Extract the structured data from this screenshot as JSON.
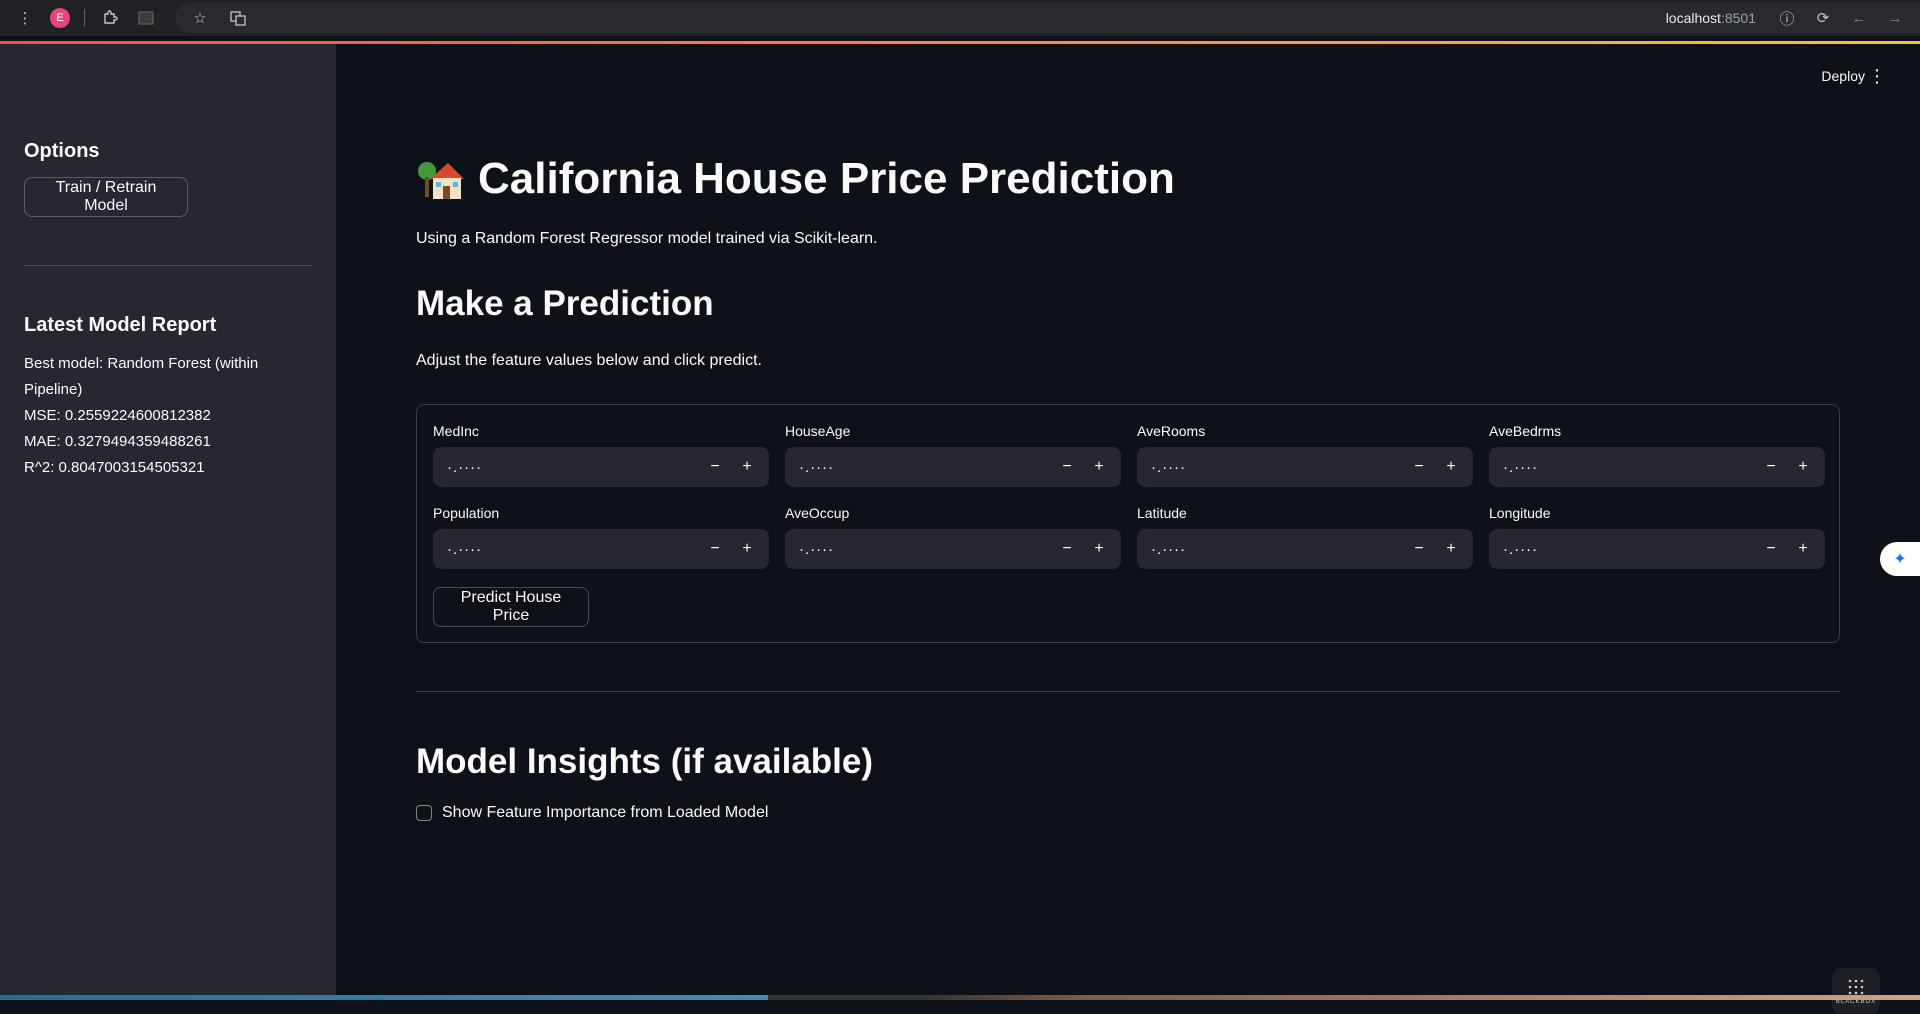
{
  "browser": {
    "profile_initial": "E",
    "url_host": "localhost",
    "url_port": ":8501"
  },
  "sidebar": {
    "options_title": "Options",
    "train_button": "Train / Retrain Model",
    "report_title": "Latest Model Report",
    "report_lines": [
      "Best model: Random Forest (within",
      "Pipeline)",
      "MSE: 0.2559224600812382",
      "MAE: 0.3279494359488261",
      "R^2: 0.8047003154505321"
    ]
  },
  "header": {
    "deploy_label": "Deploy"
  },
  "main": {
    "title": "California House Price Prediction",
    "caption": "Using a Random Forest Regressor model trained via Scikit-learn.",
    "prediction_heading": "Make a Prediction",
    "prediction_caption": "Adjust the feature values below and click predict.",
    "fields": [
      {
        "label": "MedInc",
        "value": "·.····"
      },
      {
        "label": "HouseAge",
        "value": "·.····"
      },
      {
        "label": "AveRooms",
        "value": "·.····"
      },
      {
        "label": "AveBedrms",
        "value": "·.····"
      },
      {
        "label": "Population",
        "value": "·.····"
      },
      {
        "label": "AveOccup",
        "value": "·.····"
      },
      {
        "label": "Latitude",
        "value": "·.····"
      },
      {
        "label": "Longitude",
        "value": "·.····"
      }
    ],
    "stepper_minus": "−",
    "stepper_plus": "+",
    "predict_button": "Predict House Price",
    "insights_heading": "Model Insights (if available)",
    "feature_checkbox_label": "Show Feature Importance from Loaded Model",
    "feature_checkbox_checked": false
  },
  "colors": {
    "background": "#0e1117",
    "sidebar": "#262730",
    "accent_start": "#ff4b4b",
    "accent_end": "#ffbd45"
  },
  "overlay": {
    "blackbox_label": "BLACKBOX"
  }
}
